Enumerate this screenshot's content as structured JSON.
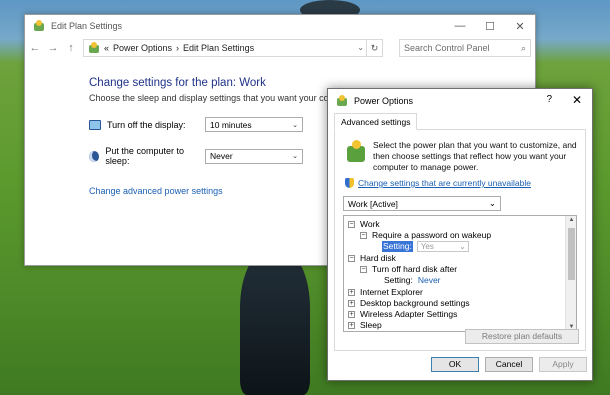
{
  "explorer": {
    "title": "Edit Plan Settings",
    "breadcrumb": {
      "prefix": "«",
      "items": [
        "Power Options",
        "Edit Plan Settings"
      ],
      "sep": "›"
    },
    "search_placeholder": "Search Control Panel",
    "heading": "Change settings for the plan: Work",
    "subtitle": "Choose the sleep and display settings that you want your computer to use.",
    "display_label": "Turn off the display:",
    "display_value": "10 minutes",
    "sleep_label": "Put the computer to sleep:",
    "sleep_value": "Never",
    "advanced_link": "Change advanced power settings"
  },
  "dialog": {
    "title": "Power Options",
    "help": "?",
    "close": "✕",
    "tab": "Advanced settings",
    "info": "Select the power plan that you want to customize, and then choose settings that reflect how you want your computer to manage power.",
    "change_link": "Change settings that are currently unavailable",
    "plan_value": "Work [Active]",
    "tree": {
      "work": "Work",
      "require_password": "Require a password on wakeup",
      "setting_label": "Setting:",
      "setting_value": "Yes",
      "hard_disk": "Hard disk",
      "turn_off_hd": "Turn off hard disk after",
      "setting_label2": "Setting:",
      "setting_value2": "Never",
      "ie": "Internet Explorer",
      "desktop_bg": "Desktop background settings",
      "wireless": "Wireless Adapter Settings",
      "sleep": "Sleep"
    },
    "restore": "Restore plan defaults",
    "ok": "OK",
    "cancel": "Cancel",
    "apply": "Apply"
  },
  "icons": {
    "minimize": "—",
    "maximize": "☐",
    "close": "✕",
    "back": "←",
    "forward": "→",
    "up": "↑",
    "refresh": "↻",
    "search": "⌕",
    "dropdown": "⌄",
    "expand_plus": "+",
    "expand_minus": "−"
  }
}
